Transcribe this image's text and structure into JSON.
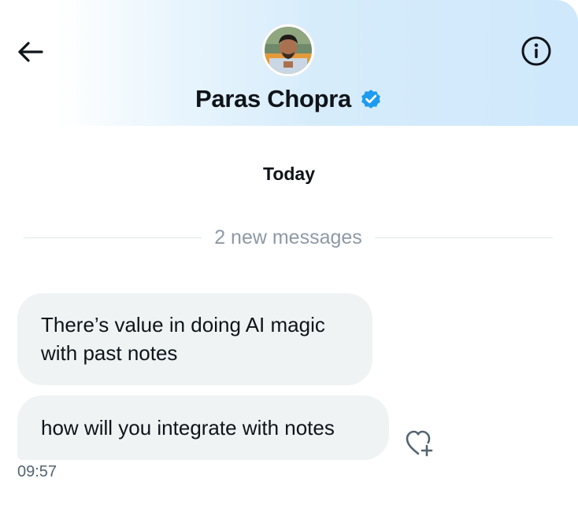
{
  "header": {
    "contact_name": "Paras Chopra",
    "verified_color": "#1d9bf0",
    "back_icon": "arrow-left-icon",
    "info_icon": "info-circle-icon"
  },
  "conversation": {
    "day_label": "Today",
    "new_messages_label": "2 new messages",
    "messages": [
      {
        "text": "There’s value in doing AI magic with past notes"
      },
      {
        "text": "how will you integrate with notes"
      }
    ],
    "last_timestamp": "09:57",
    "react_icon": "heart-plus-icon"
  }
}
